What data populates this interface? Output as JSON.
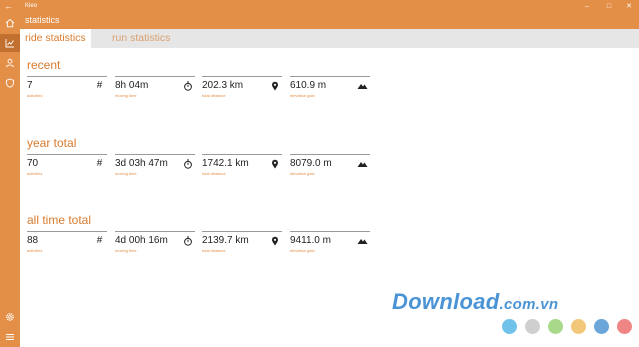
{
  "window": {
    "back_icon": "back-arrow-icon",
    "app_title": "Kleo",
    "controls": [
      "minimize-icon",
      "maximize-icon",
      "close-icon"
    ]
  },
  "header": {
    "title": "statistics"
  },
  "sidebar": {
    "items": [
      {
        "icon": "home-icon",
        "active": false
      },
      {
        "icon": "chart-icon",
        "active": true
      },
      {
        "icon": "user-icon",
        "active": false
      },
      {
        "icon": "shield-icon",
        "active": false
      }
    ],
    "bottom_items": [
      {
        "icon": "gear-icon"
      },
      {
        "icon": "hamburger-menu-icon"
      }
    ]
  },
  "tabs": [
    {
      "label": "ride statistics",
      "active": true
    },
    {
      "label": "run statistics",
      "active": false
    }
  ],
  "sections": [
    {
      "title": "recent",
      "stats": [
        {
          "value": "7",
          "label": "activities",
          "icon": "hash-icon"
        },
        {
          "value": "8h 04m",
          "label": "moving time",
          "icon": "stopwatch-icon"
        },
        {
          "value": "202.3 km",
          "label": "total distance",
          "icon": "map-pin-icon"
        },
        {
          "value": "610.9 m",
          "label": "elevation gain",
          "icon": "mountain-icon"
        }
      ]
    },
    {
      "title": "year total",
      "stats": [
        {
          "value": "70",
          "label": "activities",
          "icon": "hash-icon"
        },
        {
          "value": "3d 03h 47m",
          "label": "moving time",
          "icon": "stopwatch-icon"
        },
        {
          "value": "1742.1 km",
          "label": "total distance",
          "icon": "map-pin-icon"
        },
        {
          "value": "8079.0 m",
          "label": "elevation gain",
          "icon": "mountain-icon"
        }
      ]
    },
    {
      "title": "all time total",
      "stats": [
        {
          "value": "88",
          "label": "activities",
          "icon": "hash-icon"
        },
        {
          "value": "4d 00h 16m",
          "label": "moving time",
          "icon": "stopwatch-icon"
        },
        {
          "value": "2139.7 km",
          "label": "total distance",
          "icon": "map-pin-icon"
        },
        {
          "value": "9411.0 m",
          "label": "elevation gain",
          "icon": "mountain-icon"
        }
      ]
    }
  ],
  "colors": {
    "accent": "#e48f47",
    "accent_dark": "#c2702f",
    "tab_active_text": "#d97b2e",
    "tab_bar": "#e6e6e6"
  },
  "watermark": {
    "text": "Download",
    "suffix": ".com.vn",
    "dots": [
      "#6fc3ea",
      "#cfcfcf",
      "#a8d88a",
      "#f3c77a",
      "#6aa6d8",
      "#ef8585"
    ]
  }
}
